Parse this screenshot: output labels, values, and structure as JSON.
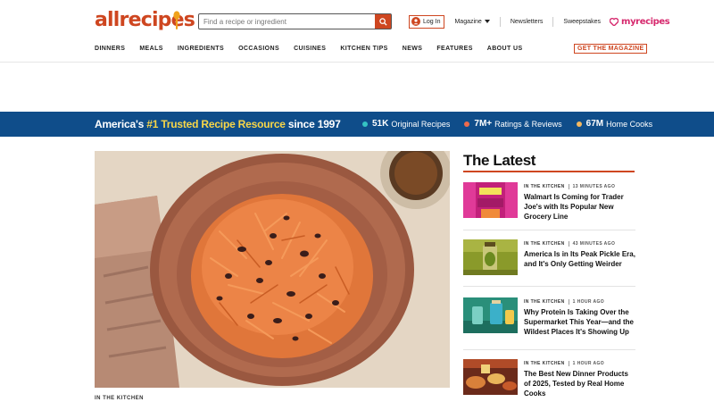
{
  "header": {
    "logo_text": "allrecipes",
    "search_placeholder": "Find a recipe or ingredient",
    "login_label": "Log In",
    "magazine_label": "Magazine",
    "newsletters_label": "Newsletters",
    "sweepstakes_label": "Sweepstakes",
    "myrecipes_label": "myrecipes",
    "accent_color": "#ce4620"
  },
  "nav": {
    "items": [
      "DINNERS",
      "MEALS",
      "INGREDIENTS",
      "OCCASIONS",
      "CUISINES",
      "KITCHEN TIPS",
      "NEWS",
      "FEATURES",
      "ABOUT US"
    ],
    "magazine_cta": "GET THE MAGAZINE"
  },
  "banner": {
    "title_pre": "America's ",
    "title_highlight": "#1 Trusted Recipe Resource",
    "title_post": " since 1997",
    "background": "#0f4d8a",
    "stats": [
      {
        "number": "51K",
        "label": "Original Recipes",
        "color": "#35c3c3"
      },
      {
        "number": "7M+",
        "label": "Ratings & Reviews",
        "color": "#ef6a4c"
      },
      {
        "number": "67M",
        "label": "Home Cooks",
        "color": "#f4b860"
      }
    ]
  },
  "hero": {
    "tag": "IN THE KITCHEN",
    "image_icon": "carrot-salad-photo"
  },
  "latest": {
    "title": "The Latest",
    "articles": [
      {
        "category": "IN THE KITCHEN",
        "time": "13 MINUTES AGO",
        "headline": "Walmart Is Coming for Trader Joe's with Its Popular New Grocery Line"
      },
      {
        "category": "IN THE KITCHEN",
        "time": "43 MINUTES AGO",
        "headline": "America Is in Its Peak Pickle Era, and It's Only Getting Weirder"
      },
      {
        "category": "IN THE KITCHEN",
        "time": "1 HOUR AGO",
        "headline": "Why Protein Is Taking Over the Supermarket This Year—and the Wildest Places It's Showing Up"
      },
      {
        "category": "IN THE KITCHEN",
        "time": "1 HOUR AGO",
        "headline": "The Best New Dinner Products of 2025, Tested by Real Home Cooks"
      }
    ]
  }
}
